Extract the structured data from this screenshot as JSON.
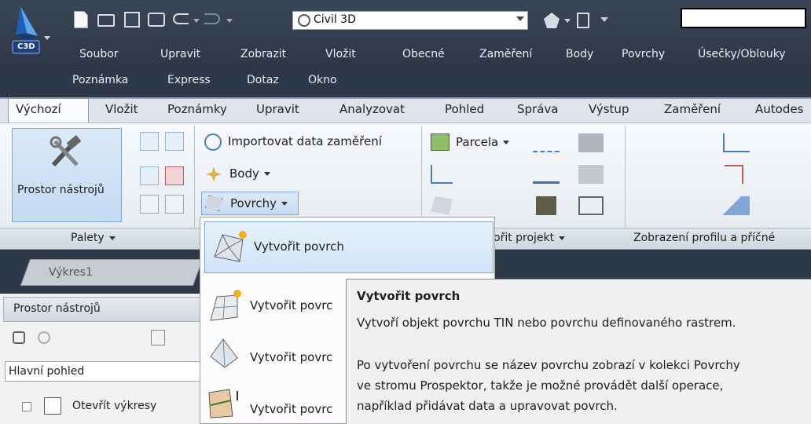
{
  "app": {
    "logo_text": "C3D",
    "workspace": "Civil 3D"
  },
  "menubar": {
    "row1": [
      "Soubor",
      "Upravit",
      "Zobrazit",
      "Vložit",
      "Obecné",
      "Zaměření",
      "Body",
      "Povrchy",
      "Úsečky/Oblouky"
    ],
    "row2": [
      "Poznámka",
      "Express",
      "Dotaz",
      "Okno"
    ]
  },
  "ribbon_tabs": [
    "Výchozí",
    "Vložit",
    "Poznámky",
    "Upravit",
    "Analyzovat",
    "Pohled",
    "Správa",
    "Výstup",
    "Zaměření",
    "Autodes"
  ],
  "ribbon": {
    "toolspace_button": "Prostor nástrojů",
    "import_survey": "Importovat data zaměření",
    "points": "Body",
    "surfaces": "Povrchy",
    "parcel": "Parcela",
    "panels": {
      "palettes": "Palety",
      "create_design": "ořit projekt",
      "profile_view": "Zobrazení profilu a příčné"
    }
  },
  "document": {
    "tab": "Výkres1"
  },
  "toolspace": {
    "title": "Prostor nástrojů",
    "view_select": "Hlavní pohled",
    "tree_item": "Otevřít výkresy"
  },
  "dropdown": {
    "items": [
      "Vytvořit povrch",
      "Vytvořit povrc",
      "Vytvořit povrc",
      "Vytvořit povrc"
    ]
  },
  "tooltip": {
    "title": "Vytvořit povrch",
    "desc": "Vytvoří objekt povrchu TIN nebo povrchu definovaného rastrem.",
    "lines": [
      "Po vytvoření povrchu se název povrchu zobrazí v kolekci Povrchy",
      "ve stromu Prospektor, takže je možné provádět další operace,",
      "například přidávat data a upravovat povrch."
    ]
  },
  "colors": {
    "accent_blue": "#1d5fb3",
    "highlight": "#cfe3f7",
    "dark_chrome": "#2d3848"
  }
}
